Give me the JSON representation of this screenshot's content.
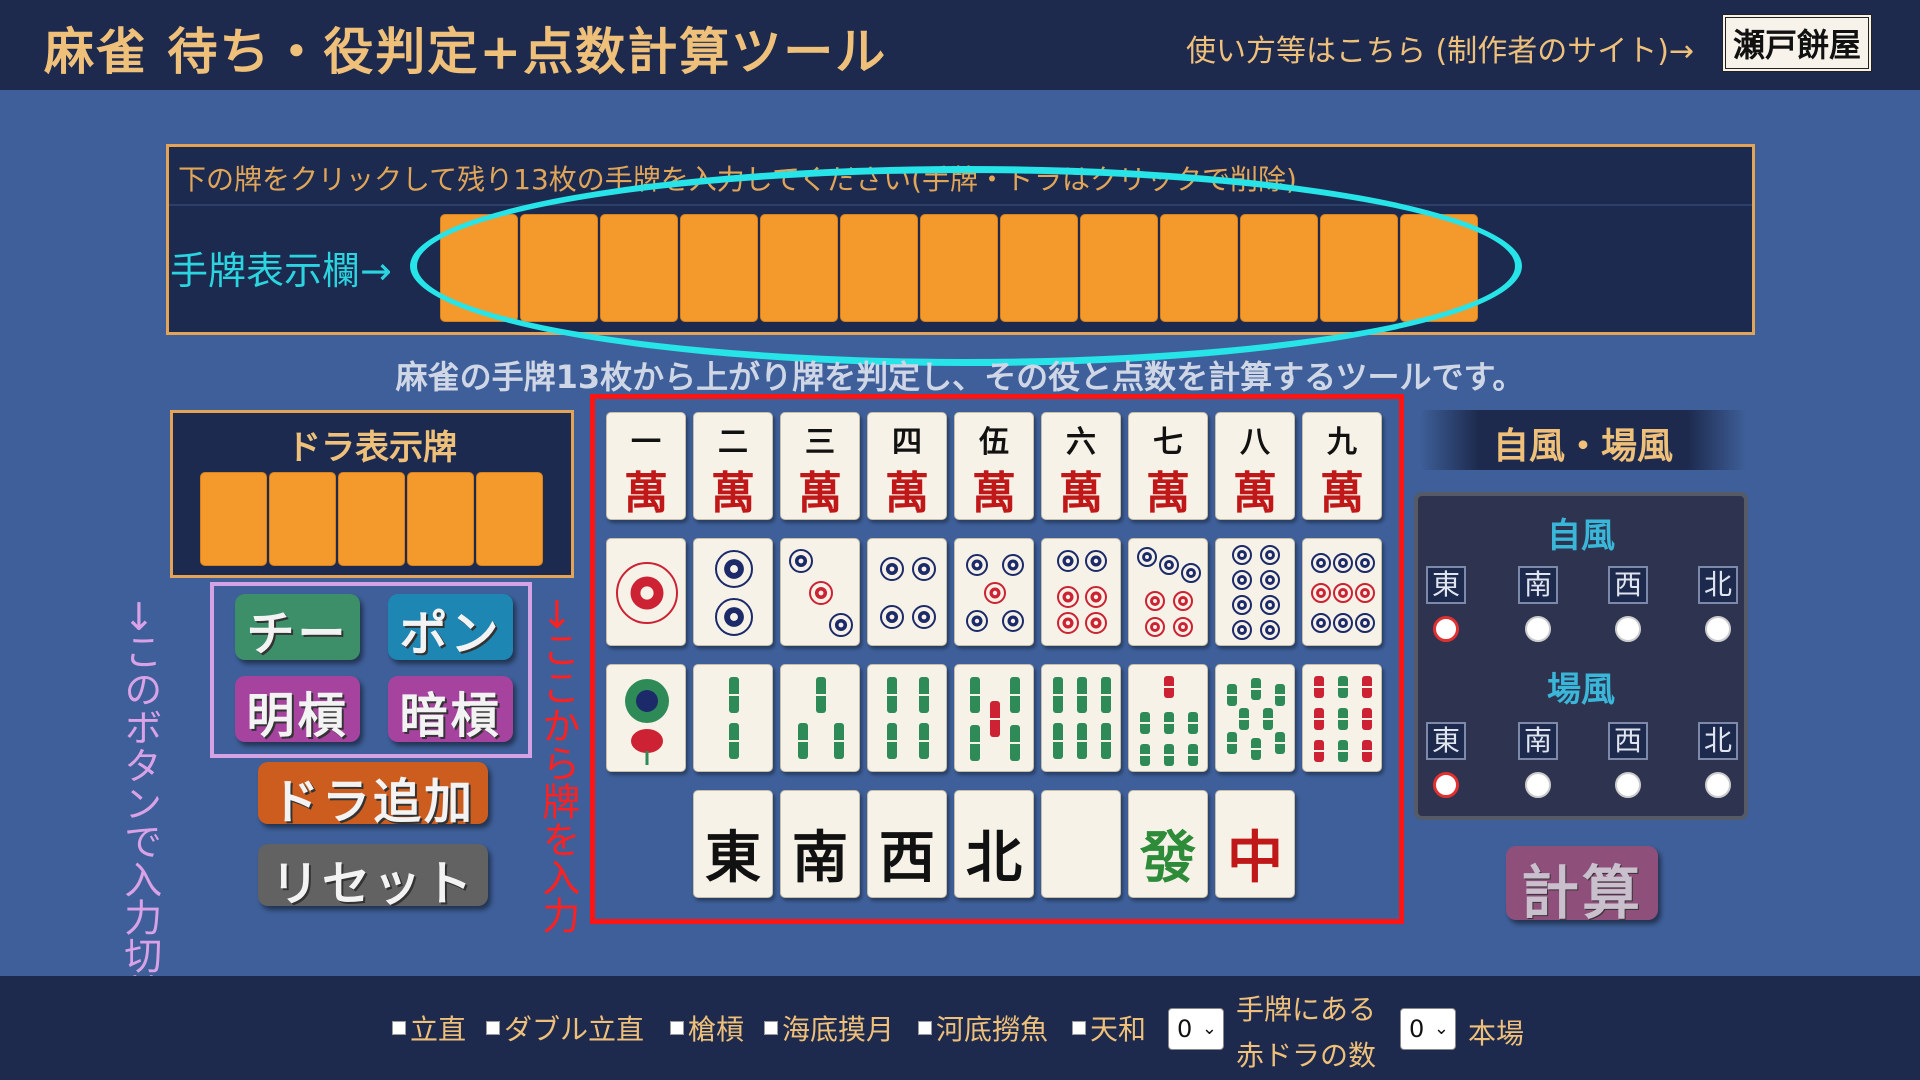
{
  "header": {
    "title": "麻雀 待ち・役判定+点数計算ツール",
    "howto_link": "使い方等はこちら (制作者のサイト)→",
    "logo_text": "瀬戸餅屋"
  },
  "hand": {
    "instruction": "下の牌をクリックして残り13枚の手牌を入力してください(手牌・ドラはクリックで削除)",
    "label": "手牌表示欄→"
  },
  "subtitle": "麻雀の手牌13枚から上がり牌を判定し、その役と点数を計算するツールです。",
  "dora": {
    "title": "ドラ表示牌"
  },
  "buttons": {
    "chi": "チー",
    "pon": "ポン",
    "minkan": "明槓",
    "ankan": "暗槓",
    "add_dora": "ドラ追加",
    "reset": "リセット",
    "calc": "計算"
  },
  "notes": {
    "mode": "→このボタンで入力切替",
    "input": "→ここから牌を入力"
  },
  "tiles": {
    "man_numbers": [
      "一",
      "二",
      "三",
      "四",
      "伍",
      "六",
      "七",
      "八",
      "九"
    ],
    "man_suffix": "萬",
    "honors": [
      "東",
      "南",
      "西",
      "北",
      "",
      "發",
      "中"
    ]
  },
  "wind": {
    "title": "自風・場風",
    "seat_label": "自風",
    "round_label": "場風",
    "options": [
      "東",
      "南",
      "西",
      "北"
    ],
    "seat_selected": "東",
    "round_selected": "東"
  },
  "footer": {
    "options": [
      "立直",
      "ダブル立直",
      "槍槓",
      "海底摸月",
      "河底撈魚",
      "天和"
    ],
    "red_dora_label_1": "手牌にある",
    "red_dora_label_2": "赤ドラの数",
    "red_dora_value": "0",
    "honba_value": "0",
    "honba_label": "本場"
  },
  "colors": {
    "background": "#3e5f99",
    "header": "#1d2a4d",
    "empty_tile": "#f49a2c",
    "highlight_ellipse": "#26e4e8",
    "input_frame": "#ff1414",
    "text_gold": "#efc07a"
  }
}
